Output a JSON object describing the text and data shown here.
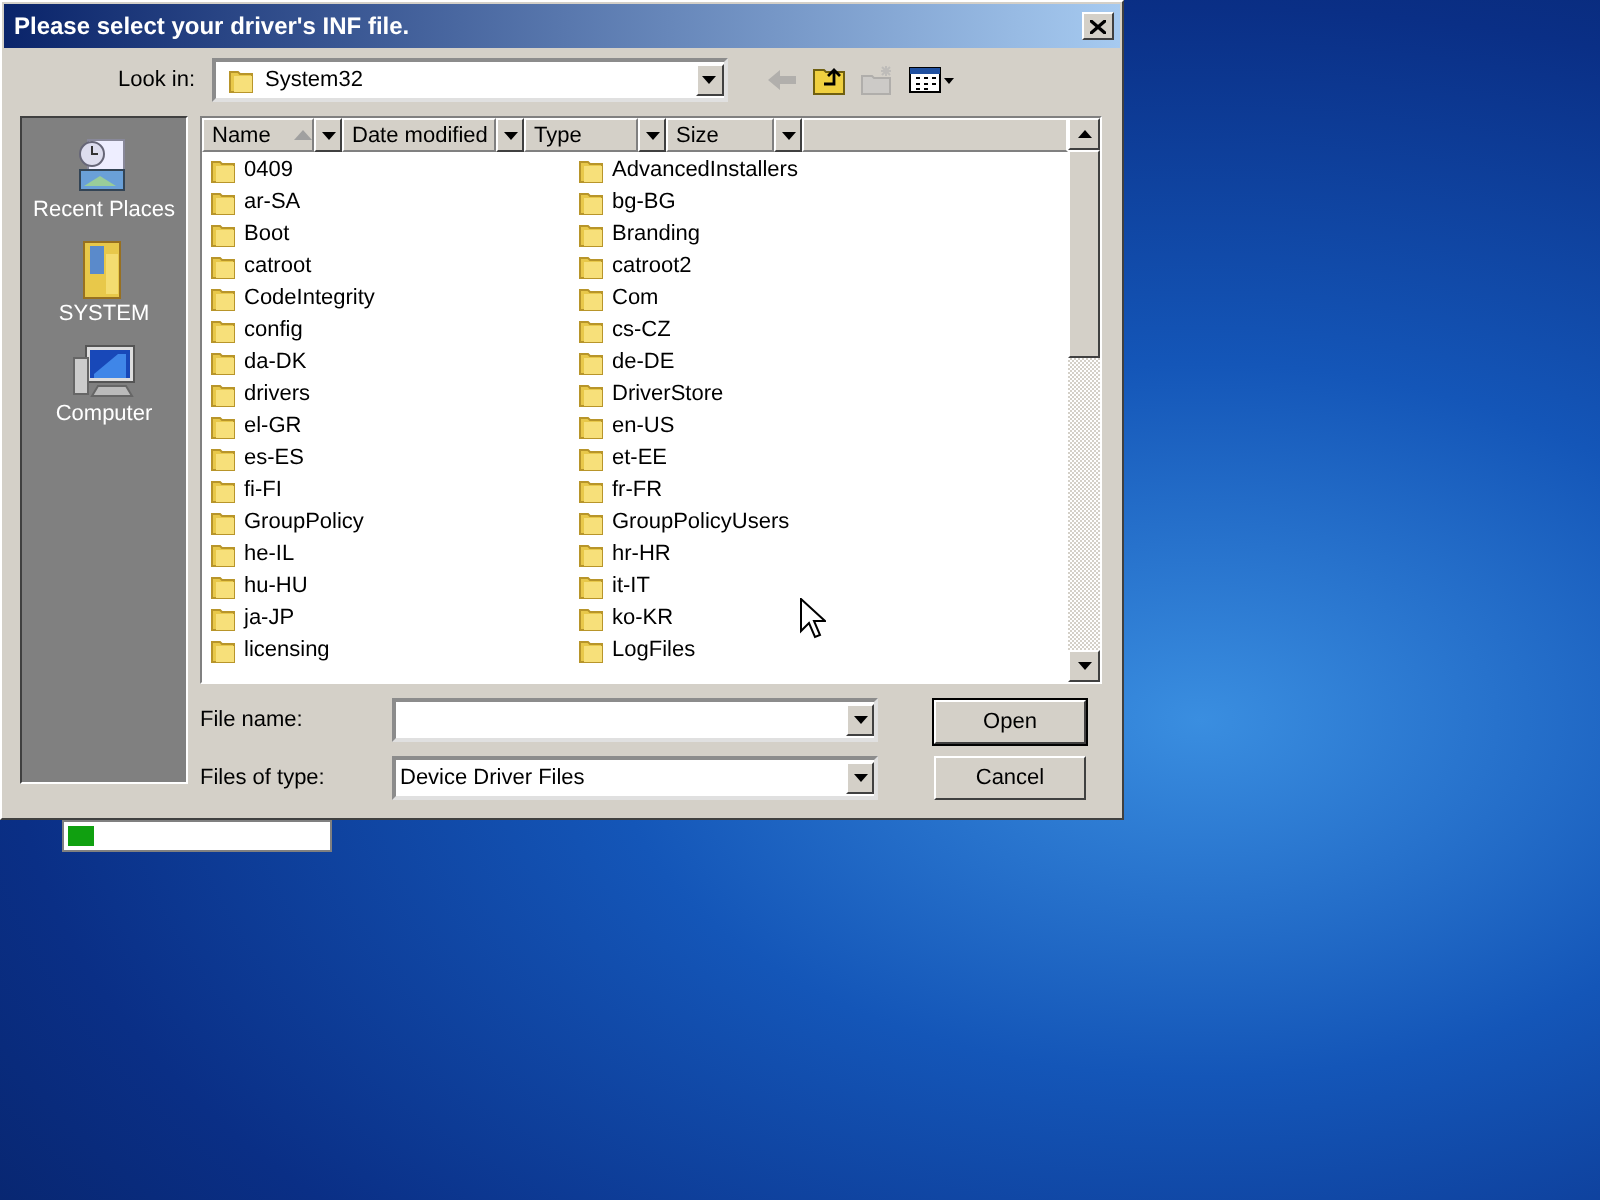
{
  "window": {
    "title": "Please select your driver's INF file."
  },
  "look_in": {
    "label": "Look in:",
    "value": "System32"
  },
  "toolbar": [
    {
      "kind": "back",
      "disabled": true
    },
    {
      "kind": "up",
      "disabled": false
    },
    {
      "kind": "new-folder",
      "disabled": true
    },
    {
      "kind": "views",
      "disabled": false
    }
  ],
  "places": [
    {
      "kind": "recent",
      "label": "Recent Places",
      "selected": false
    },
    {
      "kind": "user",
      "label": "SYSTEM",
      "selected": false
    },
    {
      "kind": "computer",
      "label": "Computer",
      "selected": false
    }
  ],
  "columns": [
    {
      "label": "Name",
      "sorted": true
    },
    {
      "label": "Date modified",
      "sorted": false
    },
    {
      "label": "Type",
      "sorted": false
    },
    {
      "label": "Size",
      "sorted": false
    }
  ],
  "files": [
    "0409",
    "ar-SA",
    "Boot",
    "catroot",
    "CodeIntegrity",
    "config",
    "da-DK",
    "drivers",
    "el-GR",
    "es-ES",
    "fi-FI",
    "GroupPolicy",
    "he-IL",
    "hu-HU",
    "ja-JP",
    "licensing",
    "AdvancedInstallers",
    "bg-BG",
    "Branding",
    "catroot2",
    "Com",
    "cs-CZ",
    "de-DE",
    "DriverStore",
    "en-US",
    "et-EE",
    "fr-FR",
    "GroupPolicyUsers",
    "hr-HR",
    "it-IT",
    "ko-KR",
    "LogFiles"
  ],
  "file_name": {
    "label": "File name:"
  },
  "file_type": {
    "label": "Files of type:",
    "value": "Device Driver Files"
  },
  "buttons": [
    {
      "label": "Open",
      "default": true
    },
    {
      "label": "Cancel",
      "default": false
    }
  ],
  "progress": {
    "level": 0.1
  }
}
